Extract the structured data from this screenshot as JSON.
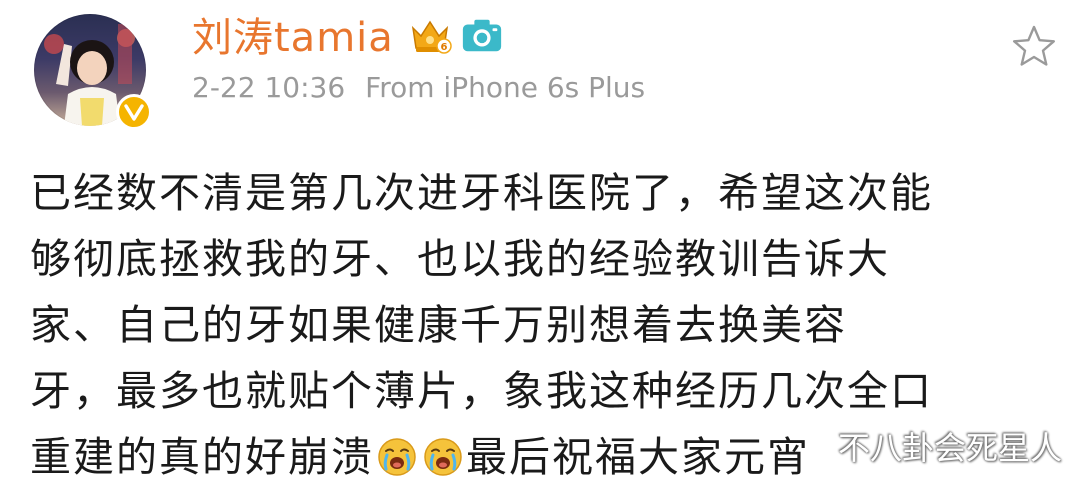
{
  "post": {
    "username": "刘涛tamia",
    "timestamp": "2-22 10:36",
    "source": "From iPhone 6s Plus",
    "lines": [
      "已经数不清是第几次进牙科医院了，希望这次能",
      "够彻底拯救我的牙、也以我的经验教训告诉大",
      "家、自己的牙如果健康千万别想着去换美容",
      "牙，最多也就贴个薄片，象我这种经历几次全口"
    ],
    "last_line_start": "重建的真的好崩溃",
    "last_line_end": "最后祝福大家元宵",
    "emoji_name": "crying-face"
  },
  "badges": {
    "crown_level": "6"
  },
  "watermark": "不八卦会死星人",
  "colors": {
    "username": "#e8762e",
    "meta": "#9a9a9a",
    "verified": "#f5b400",
    "camera_badge": "#3bb9c9",
    "crown_badge": "#f3a817"
  }
}
